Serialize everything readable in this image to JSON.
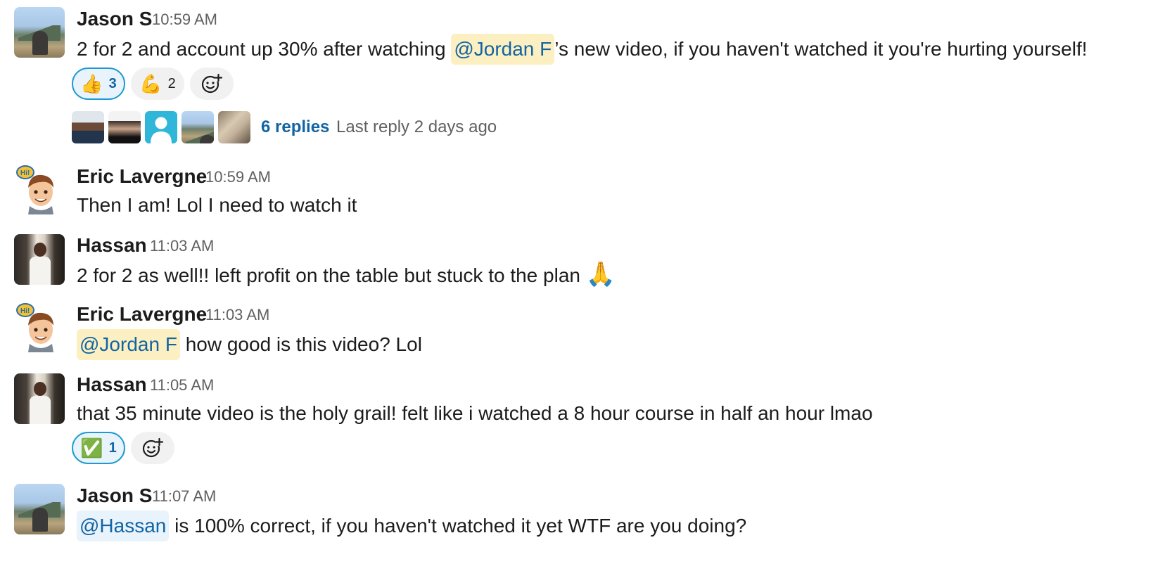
{
  "messages": [
    {
      "author": "Jason S",
      "time": "10:59 AM",
      "text_pre": "2 for 2 and account up 30% after watching ",
      "mention": "@Jordan F",
      "text_post": "’s new video, if you haven't watched it you're hurting yourself!",
      "reactions": [
        {
          "emoji": "👍",
          "count": "3"
        },
        {
          "emoji": "💪",
          "count": "2"
        }
      ],
      "thread": {
        "replies": "6 replies",
        "last_reply": "Last reply 2 days ago"
      }
    },
    {
      "author": "Eric Lavergne",
      "time": "10:59 AM",
      "text": "Then I am! Lol I need to watch it"
    },
    {
      "author": "Hassan",
      "time": "11:03 AM",
      "text": "2 for 2 as well!! left profit on the table but stuck to the plan",
      "emoji": "🙏"
    },
    {
      "author": "Eric Lavergne",
      "time": "11:03 AM",
      "mention": "@Jordan F",
      "text_post": " how good is this video? Lol"
    },
    {
      "author": "Hassan",
      "time": "11:05 AM",
      "text": "that 35 minute video is the holy grail! felt like i watched a 8 hour course in half an hour lmao",
      "reactions": [
        {
          "emoji": "✅",
          "count": "1"
        }
      ]
    },
    {
      "author": "Jason S",
      "time": "11:07 AM",
      "mention": "@Hassan",
      "text_post": " is 100% correct, if you haven't watched it yet WTF are you doing?"
    }
  ],
  "icons": {
    "add_reaction": "add-reaction-icon",
    "avatar_eric": "bitmoji-avatar-icon"
  },
  "colors": {
    "link": "#1264a3",
    "mention_bg": "#fcefc2",
    "reaction_selected_border": "#1d9bd1"
  }
}
